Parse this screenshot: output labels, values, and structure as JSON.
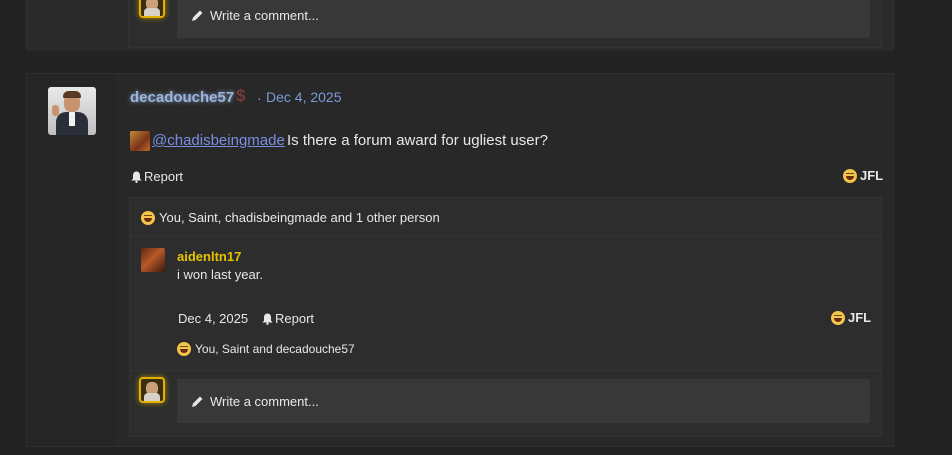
{
  "top_post": {
    "comment_placeholder": "Write a comment..."
  },
  "post": {
    "username": "decadouche57",
    "badge_icon": "dollar-sign-icon",
    "separator": "·",
    "date": "Dec 4, 2025",
    "mention": "@chadisbeingmade",
    "text": "Is there a forum award for ugliest user?",
    "report_label": "Report",
    "reaction_label": "JFL",
    "reactions_summary": "You, Saint, chadisbeingmade and 1 other person"
  },
  "reply": {
    "username": "aidenltn17",
    "text": "i won last year.",
    "date": "Dec 4, 2025",
    "report_label": "Report",
    "reaction_label": "JFL",
    "reactions_summary": "You, Saint and decadouche57"
  },
  "comment_box": {
    "placeholder": "Write a comment..."
  },
  "colors": {
    "background": "#232323",
    "username_glow": "#9bb5df",
    "link": "#7a8fe0",
    "reply_username": "#e8c400",
    "avatar_border": "#e2b100"
  }
}
